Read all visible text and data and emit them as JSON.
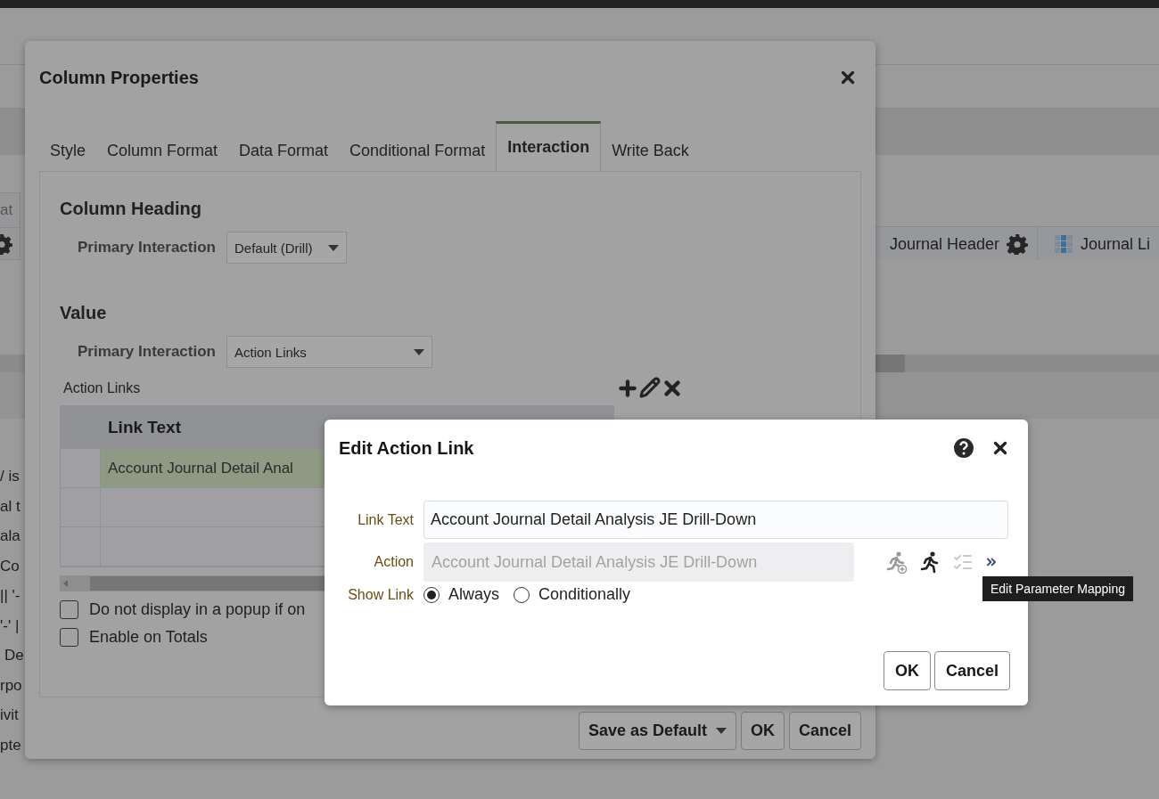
{
  "background": {
    "left_tab": {
      "label": "at"
    },
    "view_tabs": [
      {
        "label": "Journal Header",
        "kind": "gear"
      },
      {
        "label": "Journal Li",
        "kind": "grid"
      }
    ],
    "text_lines": [
      "/ is",
      "al t",
      "ala",
      "Co",
      "|| '-",
      "'-' |",
      "De",
      "rpo",
      "ivit",
      "pte"
    ]
  },
  "column_properties": {
    "title": "Column Properties",
    "tabs": [
      {
        "label": "Style",
        "selected": false
      },
      {
        "label": "Column Format",
        "selected": false
      },
      {
        "label": "Data Format",
        "selected": false
      },
      {
        "label": "Conditional Format",
        "selected": false
      },
      {
        "label": "Interaction",
        "selected": true
      },
      {
        "label": "Write Back",
        "selected": false
      }
    ],
    "sections": [
      {
        "title": "Column Heading",
        "field_label": "Primary Interaction",
        "value": "Default (Drill)"
      },
      {
        "title": "Value",
        "field_label": "Primary Interaction",
        "value": "Action Links"
      }
    ],
    "action_links": {
      "label": "Action Links",
      "columns": [
        "Link Text"
      ],
      "rows": [
        {
          "link_text": "Account Journal Detail Anal",
          "selected": true
        },
        {
          "selected": false
        },
        {
          "selected": false
        }
      ]
    },
    "checkboxes": [
      {
        "label": "Do not display in a popup if on",
        "checked": false
      },
      {
        "label": "Enable on Totals",
        "checked": false
      }
    ],
    "buttons": [
      {
        "label": "Save as Default",
        "kind": "dropdown"
      },
      {
        "label": "OK",
        "kind": "plain"
      },
      {
        "label": "Cancel",
        "kind": "plain"
      }
    ]
  },
  "edit_action_link": {
    "title": "Edit Action Link",
    "link_text": {
      "label": "Link Text",
      "value": "Account Journal Detail Analysis JE Drill-Down"
    },
    "action": {
      "label": "Action",
      "value": "Account Journal Detail Analysis JE Drill-Down",
      "disabled": true
    },
    "show_link": {
      "label": "Show Link",
      "options": [
        {
          "label": "Always",
          "selected": true
        },
        {
          "label": "Conditionally",
          "selected": false
        }
      ]
    },
    "buttons": [
      "OK",
      "Cancel"
    ],
    "tooltip": "Edit Parameter Mapping"
  }
}
